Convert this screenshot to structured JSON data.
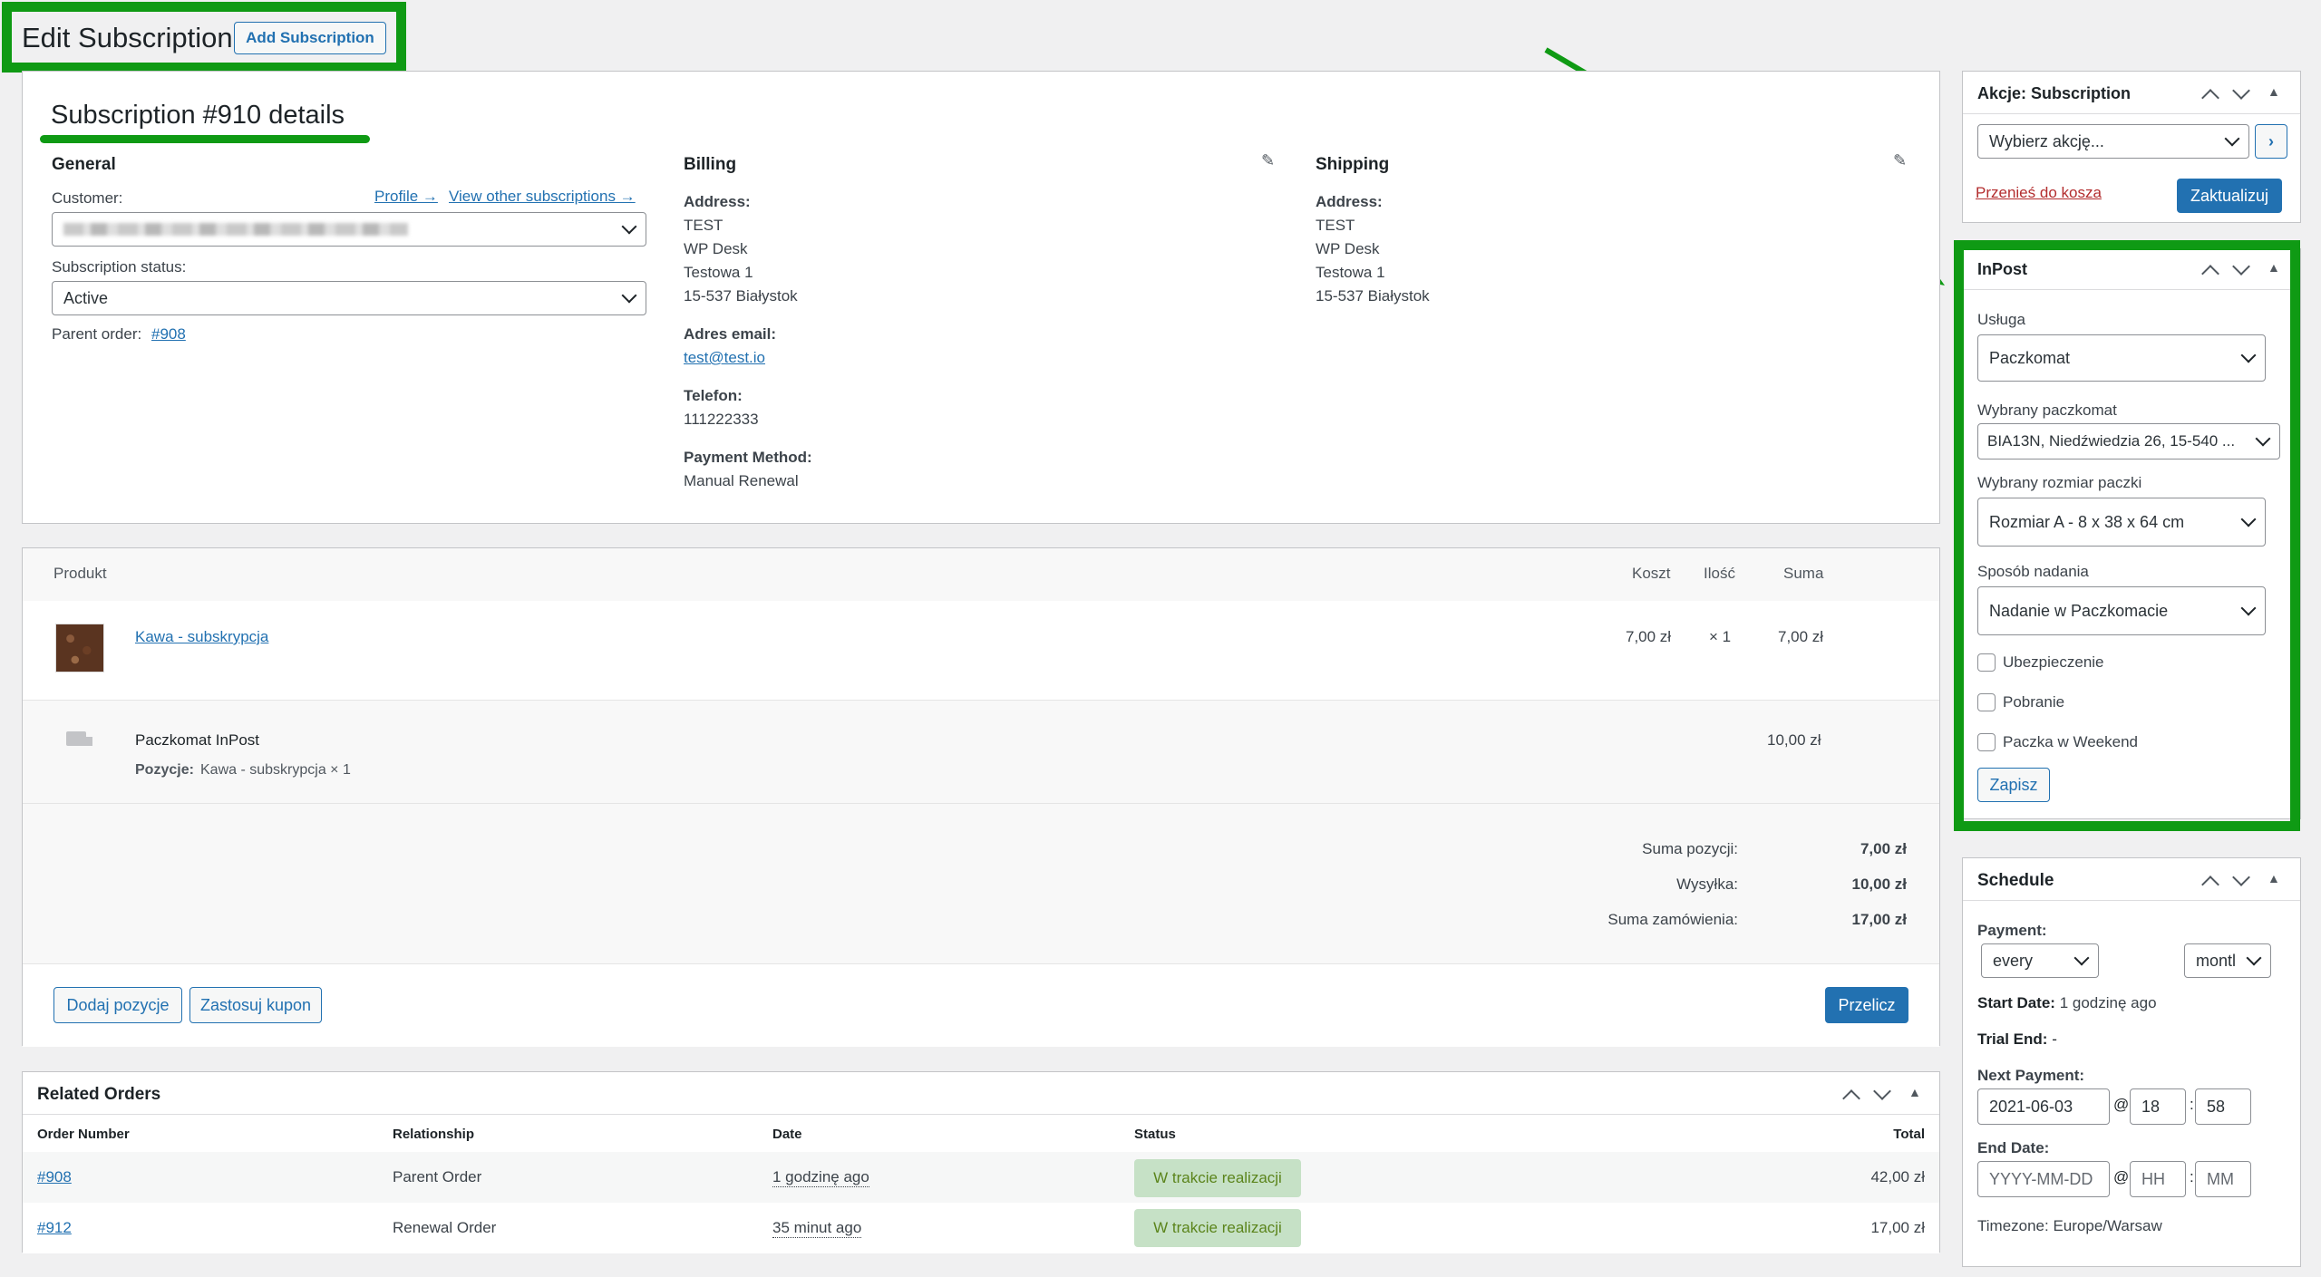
{
  "header": {
    "title": "Edit Subscription",
    "add_button": "Add Subscription"
  },
  "details": {
    "title": "Subscription #910 details",
    "general": {
      "heading": "General",
      "customer_label": "Customer:",
      "profile_link": "Profile →",
      "view_other_link": "View other subscriptions →",
      "status_label": "Subscription status:",
      "status_value": "Active",
      "parent_label": "Parent order:",
      "parent_link": "#908"
    },
    "billing": {
      "heading": "Billing",
      "address_label": "Address:",
      "address_lines": [
        "TEST",
        "WP Desk",
        "Testowa 1",
        "15-537 Białystok"
      ],
      "email_label": "Adres email:",
      "email": "test@test.io",
      "phone_label": "Telefon:",
      "phone": "111222333",
      "payment_label": "Payment Method:",
      "payment": "Manual Renewal"
    },
    "shipping": {
      "heading": "Shipping",
      "address_label": "Address:",
      "address_lines": [
        "TEST",
        "WP Desk",
        "Testowa 1",
        "15-537 Białystok"
      ]
    }
  },
  "items": {
    "col_product": "Produkt",
    "col_cost": "Koszt",
    "col_qty": "Ilość",
    "col_total": "Suma",
    "product": {
      "name": "Kawa - subskrypcja",
      "cost": "7,00 zł",
      "qty": "× 1",
      "total": "7,00 zł"
    },
    "shipping": {
      "name": "Paczkomat InPost",
      "meta_label": "Pozycje:",
      "meta_value": "Kawa - subskrypcja × 1",
      "total": "10,00 zł"
    },
    "totals": [
      {
        "label": "Suma pozycji:",
        "value": "7,00 zł"
      },
      {
        "label": "Wysyłka:",
        "value": "10,00 zł"
      },
      {
        "label": "Suma zamówienia:",
        "value": "17,00 zł"
      }
    ],
    "add_item_btn": "Dodaj pozycje",
    "coupon_btn": "Zastosuj kupon",
    "recalc_btn": "Przelicz"
  },
  "related": {
    "title": "Related Orders",
    "cols": [
      "Order Number",
      "Relationship",
      "Date",
      "Status",
      "Total"
    ],
    "rows": [
      {
        "number": "#908",
        "relationship": "Parent Order",
        "date": "1 godzinę ago",
        "status": "W trakcie realizacji",
        "total": "42,00 zł"
      },
      {
        "number": "#912",
        "relationship": "Renewal Order",
        "date": "35 minut ago",
        "status": "W trakcie realizacji",
        "total": "17,00 zł"
      }
    ]
  },
  "actions": {
    "title": "Akcje: Subscription",
    "select": "Wybierz akcję...",
    "trash": "Przenieś do kosza",
    "update": "Zaktualizuj"
  },
  "inpost": {
    "title": "InPost",
    "service_label": "Usługa",
    "service": "Paczkomat",
    "locker_label": "Wybrany paczkomat",
    "locker": "BIA13N, Niedźwiedzia 26, 15-540 ...",
    "size_label": "Wybrany rozmiar paczki",
    "size": "Rozmiar A - 8 x 38 x 64 cm",
    "method_label": "Sposób nadania",
    "method": "Nadanie w Paczkomacie",
    "insurance": "Ubezpieczenie",
    "cod": "Pobranie",
    "weekend": "Paczka w Weekend",
    "save": "Zapisz"
  },
  "schedule": {
    "title": "Schedule",
    "payment_label": "Payment:",
    "every": "every",
    "period": "montl",
    "start_label": "Start Date:",
    "start_value": "1 godzinę ago",
    "trial_label": "Trial End:",
    "trial_value": "-",
    "next_label": "Next Payment:",
    "next_date": "2021-06-03",
    "next_hh": "18",
    "next_mm": "58",
    "end_label": "End Date:",
    "end_date_ph": "YYYY-MM-DD",
    "end_hh_ph": "HH",
    "end_mm_ph": "MM",
    "at": "@",
    "colon": ":",
    "timezone": "Timezone: Europe/Warsaw"
  },
  "colors": {
    "highlight": "#0f9a14",
    "primary": "#2271b1",
    "status_bg": "#c6e1c6",
    "status_text": "#5b841b",
    "trash": "#b32d2e"
  }
}
